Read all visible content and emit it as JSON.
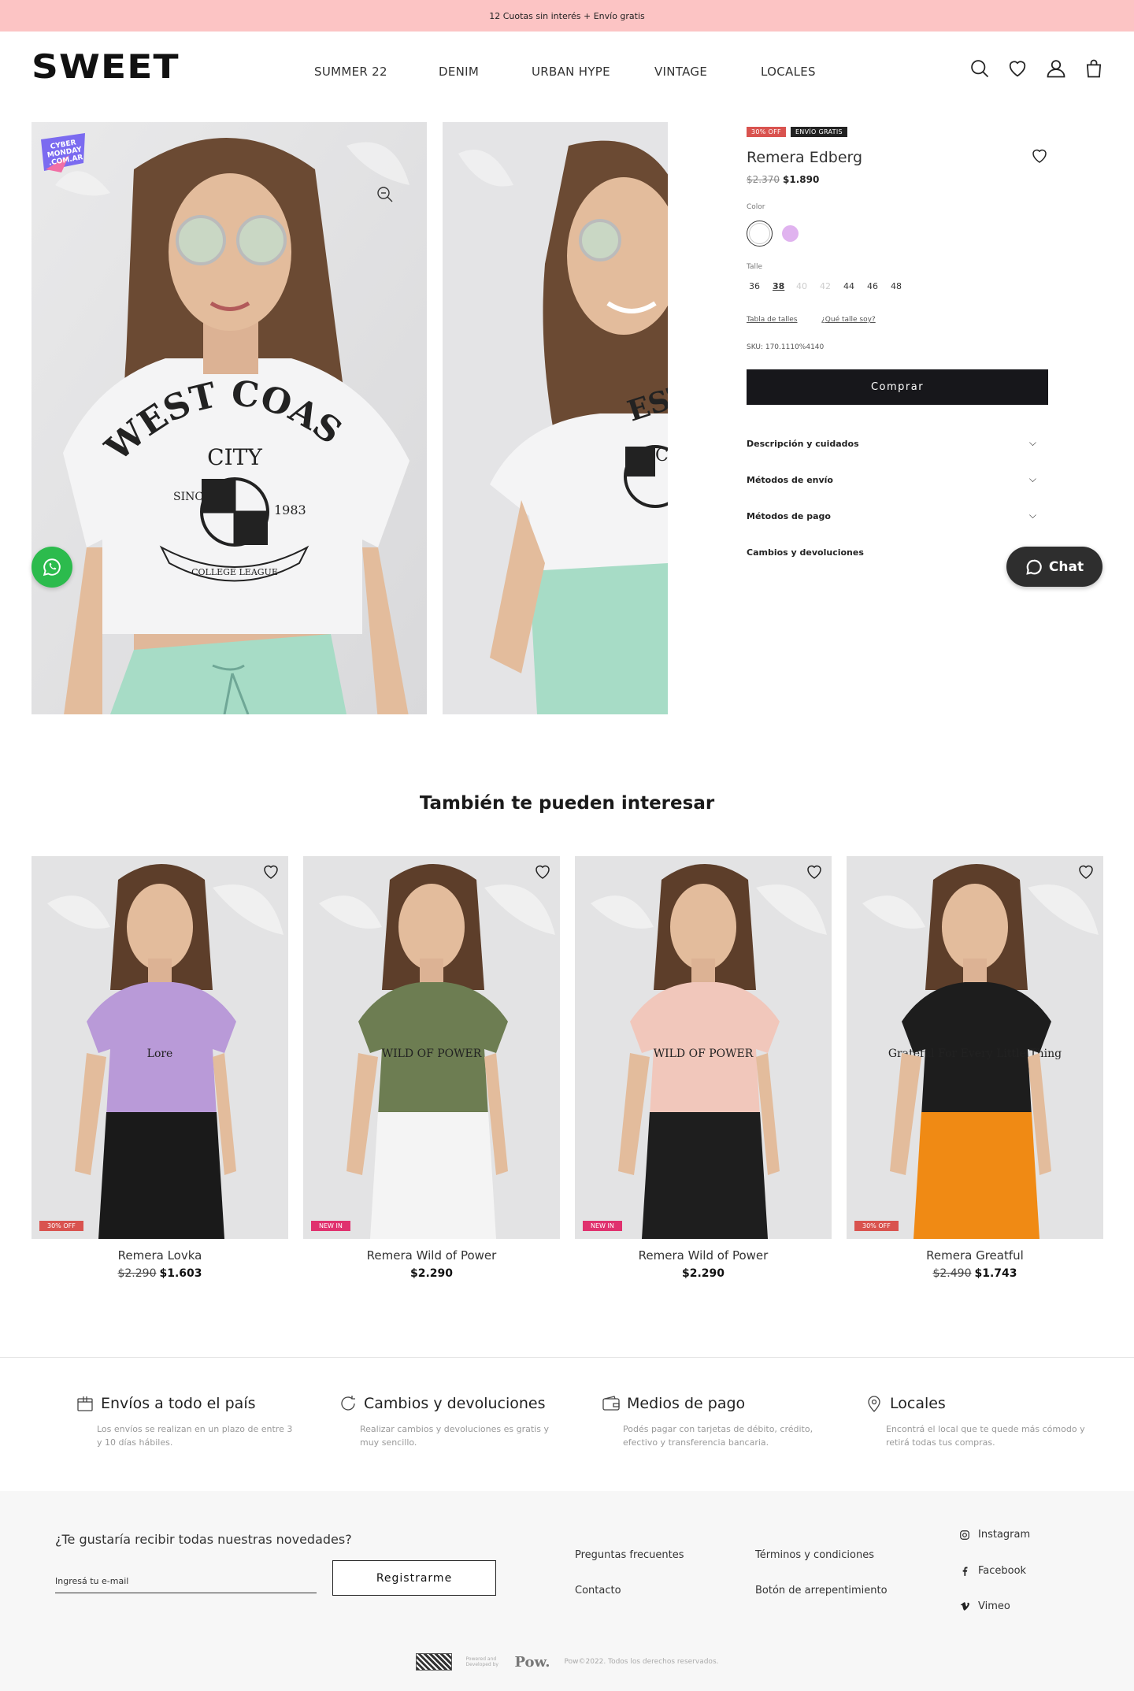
{
  "banner": "12 Cuotas sin interés + Envío gratis",
  "brand": "SWEET",
  "nav": [
    "SUMMER 22",
    "DENIM",
    "URBAN HYPE",
    "VINTAGE",
    "LOCALES"
  ],
  "product": {
    "badge_discount": "30% OFF",
    "badge_shipping": "ENVÍO GRATIS",
    "cyber_badge": "CYBER MONDAY .COM.AR",
    "name": "Remera Edberg",
    "old_price": "$2.370",
    "price": "$1.890",
    "color_label": "Color",
    "colors": [
      "#ffffff",
      "#e0b3ef"
    ],
    "size_label": "Talle",
    "sizes": [
      "36",
      "38",
      "40",
      "42",
      "44",
      "46",
      "48"
    ],
    "size_selected": "38",
    "size_unavailable": [
      "40",
      "42"
    ],
    "size_table": "Tabla de talles",
    "which_size": "¿Qué talle soy?",
    "sku": "SKU: 170.1110%4140",
    "buy": "Comprar",
    "accordions": [
      "Descripción y cuidados",
      "Métodos de envío",
      "Métodos de pago",
      "Cambios y devoluciones"
    ],
    "shirt_text": [
      "WEST COAST",
      "CITY",
      "SINCE",
      "1983",
      "COLLEGE LEAGUE"
    ]
  },
  "chat": "Chat",
  "related": {
    "title": "También te pueden interesar",
    "items": [
      {
        "name": "Remera Lovka",
        "old_price": "$2.290",
        "price": "$1.603",
        "badge": "30% OFF",
        "shirt": "#b99ad8",
        "bottom": "#1a1a1a",
        "print": "Lore"
      },
      {
        "name": "Remera Wild of Power",
        "old_price": "",
        "price": "$2.290",
        "badge": "NEW IN",
        "shirt": "#6d7d52",
        "bottom": "#f4f4f4",
        "print": "WILD OF POWER"
      },
      {
        "name": "Remera Wild of Power",
        "old_price": "",
        "price": "$2.290",
        "badge": "NEW IN",
        "shirt": "#f1c7bb",
        "bottom": "#1e1e1e",
        "print": "WILD OF POWER"
      },
      {
        "name": "Remera Greatful",
        "old_price": "$2.490",
        "price": "$1.743",
        "badge": "30% OFF",
        "shirt": "#1d1d1d",
        "bottom": "#f08a14",
        "print": "Grateful For Every Little Thing"
      }
    ]
  },
  "features": [
    {
      "title": "Envíos a todo el país",
      "desc": "Los envíos se realizan en un plazo de entre 3 y 10 días hábiles.",
      "icon": "box-icon"
    },
    {
      "title": "Cambios y devoluciones",
      "desc": "Realizar cambios y devoluciones es gratis y muy sencillo.",
      "icon": "refresh-icon"
    },
    {
      "title": "Medios de pago",
      "desc": "Podés pagar con tarjetas de débito, crédito, efectivo y transferencia bancaria.",
      "icon": "wallet-icon"
    },
    {
      "title": "Locales",
      "desc": "Encontrá el local que  te quede más cómodo y retirá todas tus compras.",
      "icon": "location-icon"
    }
  ],
  "footer": {
    "newsletter_q": "¿Te gustaría recibir todas nuestras novedades?",
    "email_placeholder": "Ingresá tu e-mail",
    "register": "Registrarme",
    "links": [
      "Preguntas frecuentes",
      "Contacto",
      "Términos y condiciones",
      "Botón de arrepentimiento"
    ],
    "social": [
      "Instagram",
      "Facebook",
      "Vimeo"
    ],
    "powered": "Powered and Developed by",
    "pow": "Pow.",
    "copyright": "Pow©2022. Todos los derechos reservados."
  },
  "colors": {
    "banner": "#fcc4c4",
    "badge_red": "#d9534f",
    "badge_pink": "#e0316e",
    "dark": "#17171b",
    "mint": "#a7dcc6"
  }
}
